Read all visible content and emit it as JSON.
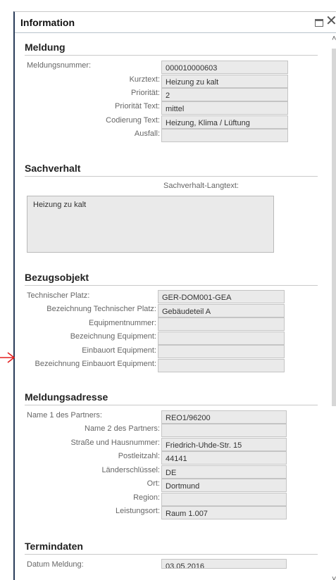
{
  "dialog": {
    "title": "Information"
  },
  "meldung": {
    "title": "Meldung",
    "fields": [
      {
        "label": "Meldungsnummer:",
        "value": "000010000603"
      },
      {
        "label": "Kurztext:",
        "value": "Heizung zu kalt"
      },
      {
        "label": "Priorität:",
        "value": "2"
      },
      {
        "label": "Priorität Text:",
        "value": "mittel"
      },
      {
        "label": "Codierung Text:",
        "value": "Heizung, Klima / Lüftung"
      },
      {
        "label": "Ausfall:",
        "value": ""
      }
    ]
  },
  "sachverhalt": {
    "title": "Sachverhalt",
    "langtext_label": "Sachverhalt-Langtext:",
    "langtext_value": "Heizung zu kalt"
  },
  "bezugsobjekt": {
    "title": "Bezugsobjekt",
    "fields": [
      {
        "label": "Technischer Platz:",
        "value": "GER-DOM001-GEA"
      },
      {
        "label": "Bezeichnung Technischer Platz:",
        "value": "Gebäudeteil A"
      },
      {
        "label": "Equipmentnummer:",
        "value": ""
      },
      {
        "label": "Bezeichnung Equipment:",
        "value": ""
      },
      {
        "label": "Einbauort Equipment:",
        "value": ""
      },
      {
        "label": "Bezeichnung Einbauort Equipment:",
        "value": ""
      }
    ]
  },
  "adresse": {
    "title": "Meldungsadresse",
    "fields": [
      {
        "label": "Name 1 des Partners:",
        "value": "REO1/96200"
      },
      {
        "label": "Name 2 des Partners:",
        "value": ""
      },
      {
        "label": "Straße und Hausnummer:",
        "value": "Friedrich-Uhde-Str. 15"
      },
      {
        "label": "Postleitzahl:",
        "value": "44141"
      },
      {
        "label": "Länderschlüssel:",
        "value": "DE"
      },
      {
        "label": "Ort:",
        "value": "Dortmund"
      },
      {
        "label": "Region:",
        "value": ""
      },
      {
        "label": "Leistungsort:",
        "value": "Raum 1.007"
      }
    ]
  },
  "termindaten": {
    "title": "Termindaten",
    "fields": [
      {
        "label": "Datum Meldung:",
        "value": "03.05.2016"
      }
    ]
  },
  "icons": {
    "maximize": "maximize-icon",
    "close": "close-icon",
    "arrow": "red-arrow-icon"
  },
  "colors": {
    "arrow": "#e32020",
    "dialog_border": "#2a3d5a",
    "field_bg": "#eaeaea"
  }
}
